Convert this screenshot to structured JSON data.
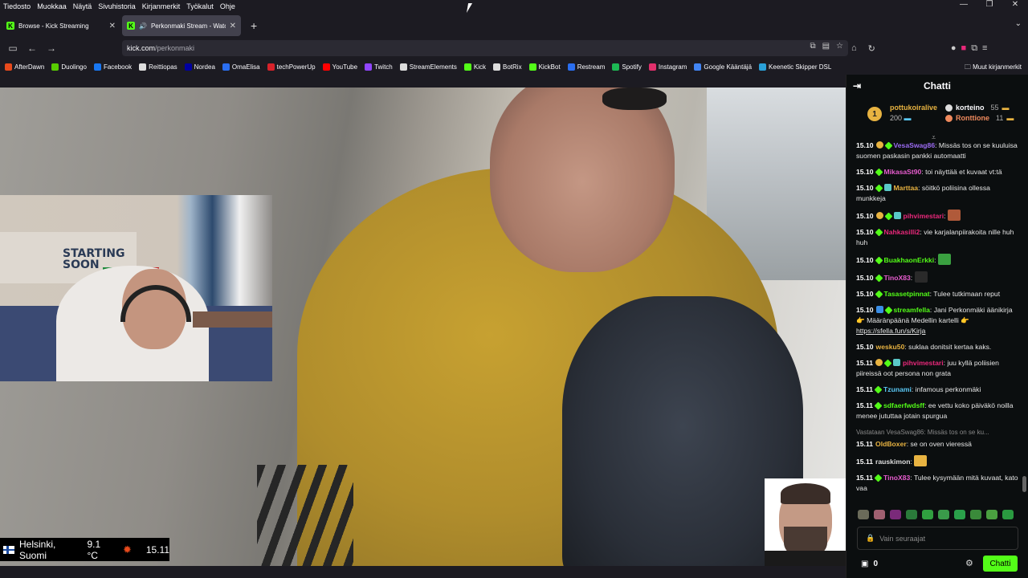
{
  "menubar": [
    "Tiedosto",
    "Muokkaa",
    "Näytä",
    "Sivuhistoria",
    "Kirjanmerkit",
    "Työkalut",
    "Ohje"
  ],
  "tabs": [
    {
      "title": "Browse - Kick Streaming"
    },
    {
      "title": "Perkonmaki Stream - Watch"
    }
  ],
  "url": {
    "host": "kick.com",
    "path": "/perkonmaki"
  },
  "bookmarks": [
    {
      "label": "AfterDawn",
      "color": "#e84a1c"
    },
    {
      "label": "Duolingo",
      "color": "#58cc02"
    },
    {
      "label": "Facebook",
      "color": "#1877f2"
    },
    {
      "label": "Reittiopas",
      "color": "#ddd"
    },
    {
      "label": "Nordea",
      "color": "#0000a0"
    },
    {
      "label": "OmaElisa",
      "color": "#2a6ef0"
    },
    {
      "label": "techPowerUp",
      "color": "#d8222a"
    },
    {
      "label": "YouTube",
      "color": "#ff0000"
    },
    {
      "label": "Twitch",
      "color": "#9146ff"
    },
    {
      "label": "StreamElements",
      "color": "#ddd"
    },
    {
      "label": "Kick",
      "color": "#53fc18"
    },
    {
      "label": "BotRix",
      "color": "#ddd"
    },
    {
      "label": "KickBot",
      "color": "#53fc18"
    },
    {
      "label": "Restream",
      "color": "#2a6ef0"
    },
    {
      "label": "Spotify",
      "color": "#1db954"
    },
    {
      "label": "Instagram",
      "color": "#e1306c"
    },
    {
      "label": "Google Kääntäjä",
      "color": "#4285f4"
    },
    {
      "label": "Keenetic Skipper DSL",
      "color": "#2aa0d8"
    }
  ],
  "other_bookmarks": "Muut kirjanmerkit",
  "weather": {
    "location": "Helsinki, Suomi",
    "temp": "9.1 °C",
    "time": "15.11"
  },
  "chat": {
    "title": "Chatti",
    "leaders": {
      "first": {
        "rank": "1",
        "name": "pottukoiralive",
        "count": "200"
      },
      "second": {
        "name": "korteino",
        "count": "55"
      },
      "third": {
        "name": "Ronttione",
        "count": "11"
      }
    },
    "messages": [
      {
        "ts": "15.10",
        "user": "VesaSwag86",
        "color": "#9b6bf2",
        "text": "Missäs tos on se kuuluisa suomen paskasin pankki automaatti"
      },
      {
        "ts": "15.10",
        "user": "MikasaSt90",
        "color": "#e85dcf",
        "text": "toi näyttää et kuvaat vt:tä"
      },
      {
        "ts": "15.10",
        "user": "Marttaa",
        "color": "#e8b341",
        "text": "söitkö poliisina ollessa munkkeja"
      },
      {
        "ts": "15.10",
        "user": "pihvimestari",
        "color": "#e8287a",
        "text": ""
      },
      {
        "ts": "15.10",
        "user": "Nahkasilli2",
        "color": "#e8287a",
        "text": "vie karjalanpiirakoita nille huh huh"
      },
      {
        "ts": "15.10",
        "user": "BuakhaonErkki",
        "color": "#53fc18",
        "text": ""
      },
      {
        "ts": "15.10",
        "user": "TinoX83",
        "color": "#e85dcf",
        "text": ""
      },
      {
        "ts": "15.10",
        "user": "Tasasetpinnat",
        "color": "#53fc18",
        "text": "Tulee tutkimaan reput"
      },
      {
        "ts": "15.10",
        "user": "streamfella",
        "color": "#53fc18",
        "text": "Jani Perkonmäki äänikirja 👉 Määränpäänä Medellin kartelli 👉"
      },
      {
        "ts": "15.10",
        "user": "wesku50",
        "color": "#e8b341",
        "text": "suklaa donitsit kertaa kaks."
      },
      {
        "ts": "15.11",
        "user": "pihvimestari",
        "color": "#e8287a",
        "text": "juu kyllä poliisien piireissä oot persona non grata"
      },
      {
        "ts": "15.11",
        "user": "Tzunami",
        "color": "#5ac8f5",
        "text": "infamous perkonmäki"
      },
      {
        "ts": "15.11",
        "user": "sdfaerfwdsff",
        "color": "#53fc18",
        "text": "ee vettu koko päiväkö noilla menee jututtaa jotain spurgua"
      },
      {
        "ts": "15.11",
        "user": "OldBoxer",
        "color": "#e8b341",
        "text": "se on oven vieressä"
      },
      {
        "ts": "15.11",
        "user": "rauskimon",
        "color": "#ddd",
        "text": ""
      },
      {
        "ts": "15.11",
        "user": "TinoX83",
        "color": "#e85dcf",
        "text": "Tulee kysymään mitä kuvaat, kato vaa"
      }
    ],
    "link": "https://sfella.fun/s/Kirja",
    "reply_to": "Vastataan VesaSwag86: Missäs tos on se ku...",
    "input_placeholder": "Vain seuraajat",
    "count": "0",
    "send": "Chatti"
  }
}
